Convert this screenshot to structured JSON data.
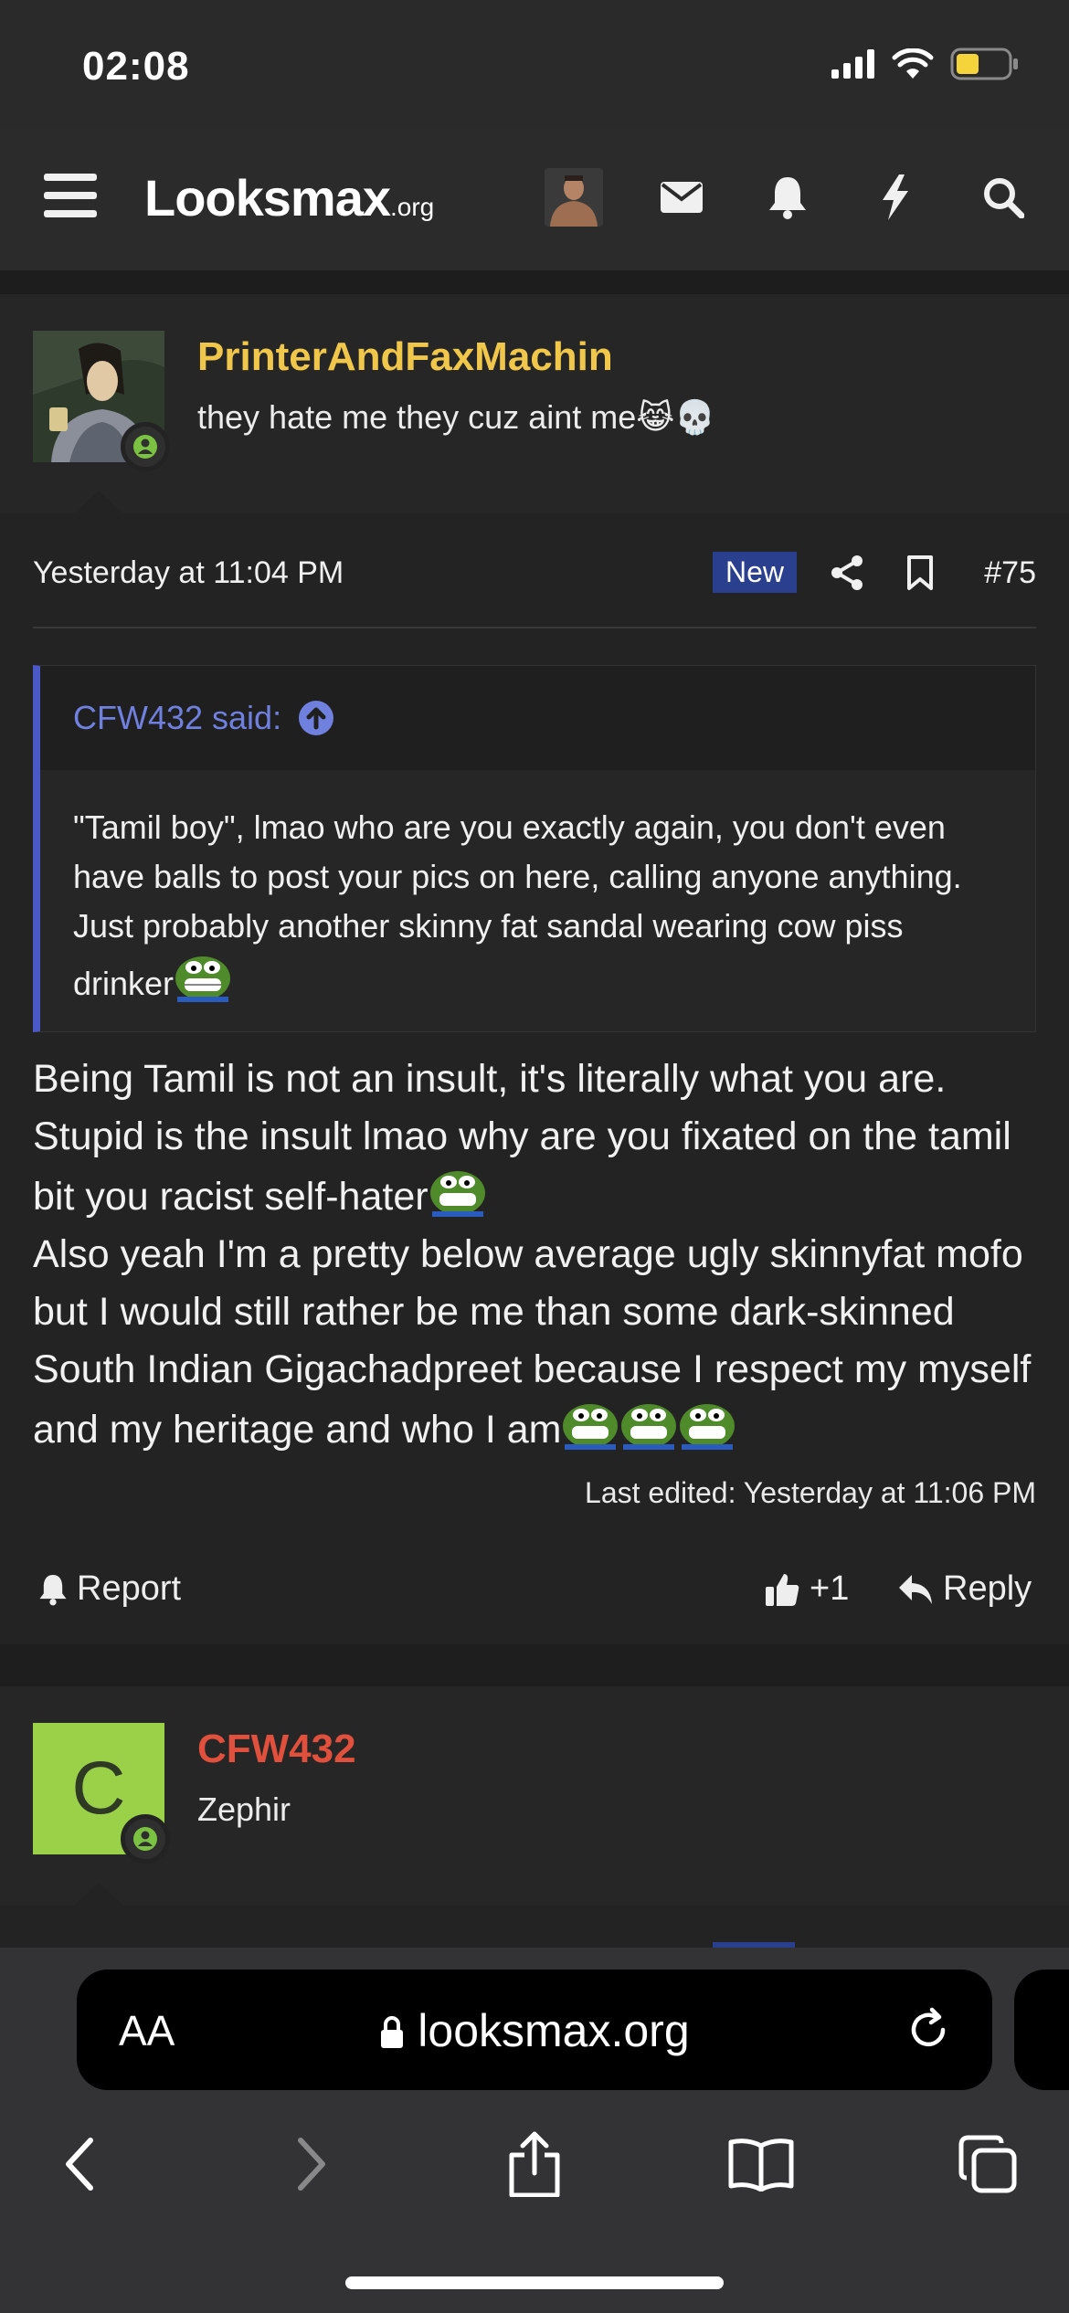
{
  "status_bar": {
    "time": "02:08"
  },
  "nav": {
    "logo_main": "Looksmax",
    "logo_suffix": ".org"
  },
  "post1": {
    "username": "PrinterAndFaxMachin",
    "username_color": "#f0c74a",
    "user_title": "they hate me they cuz aint me😹💀",
    "date": "Yesterday at 11:04 PM",
    "badge": "New",
    "post_number": "#75",
    "quote": {
      "author": "CFW432 said:",
      "text": "\"Tamil boy\", lmao who are you exactly again, you don't even have balls to post your pics on here, calling anyone anything. Just probably another skinny fat sandal wearing cow piss drinker"
    },
    "body": {
      "p1": "Being Tamil is not an insult, it's literally what you are. Stupid is the insult lmao why are you fixated on the tamil bit you racist self-hater",
      "p2": "Also yeah I'm a pretty below average ugly skinnyfat mofo but I would still rather be me than some dark-skinned South Indian Gigachadpreet because I respect my myself and my heritage and who I am"
    },
    "edited": "Last edited: Yesterday at 11:06 PM",
    "actions": {
      "report": "Report",
      "reactions": "+1",
      "reply": "Reply"
    }
  },
  "post2": {
    "avatar_letter": "C",
    "username": "CFW432",
    "username_color": "#e0503c",
    "user_title": "Zephir"
  },
  "safari": {
    "aa": "AA",
    "url": "looksmax.org"
  },
  "colors": {
    "accent_blue": "#4a58c8",
    "badge_blue": "#2b3f8f",
    "online_green": "#7cc242"
  }
}
